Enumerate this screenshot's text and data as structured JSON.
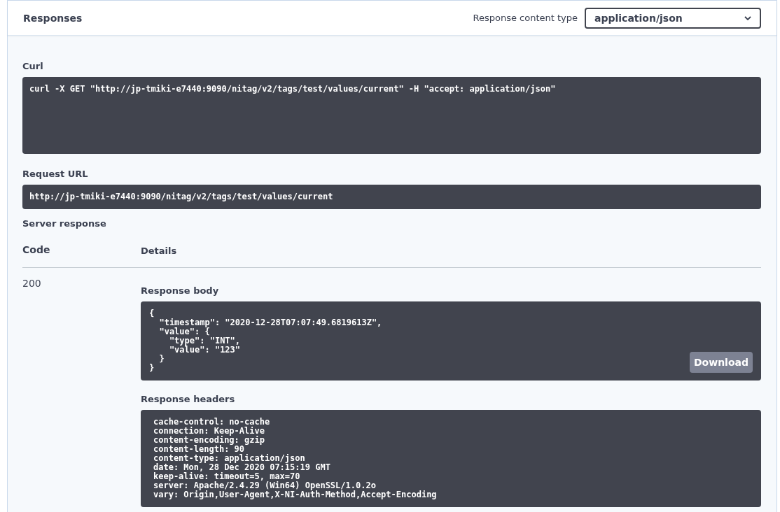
{
  "header": {
    "title": "Responses",
    "content_type_label": "Response content type",
    "content_type_value": "application/json"
  },
  "curl": {
    "label": "Curl",
    "command": "curl -X GET \"http://jp-tmiki-e7440:9090/nitag/v2/tags/test/values/current\" -H \"accept: application/json\""
  },
  "request_url": {
    "label": "Request URL",
    "url": "http://jp-tmiki-e7440:9090/nitag/v2/tags/test/values/current"
  },
  "server_response": {
    "label": "Server response",
    "columns": [
      "Code",
      "Details"
    ],
    "code": "200",
    "body_label": "Response body",
    "body": "{\n  \"timestamp\": \"2020-12-28T07:07:49.6819613Z\",\n  \"value\": {\n    \"type\": \"INT\",\n    \"value\": \"123\"\n  }\n}",
    "download": "Download",
    "headers_label": "Response headers",
    "headers": [
      "cache-control: no-cache",
      "connection: Keep-Alive",
      "content-encoding: gzip",
      "content-length: 90",
      "content-type: application/json",
      "date: Mon, 28 Dec 2020 07:15:19 GMT",
      "keep-alive: timeout=5, max=70",
      "server: Apache/2.4.29 (Win64) OpenSSL/1.0.2o",
      "vary: Origin,User-Agent,X-NI-Auth-Method,Accept-Encoding"
    ]
  }
}
